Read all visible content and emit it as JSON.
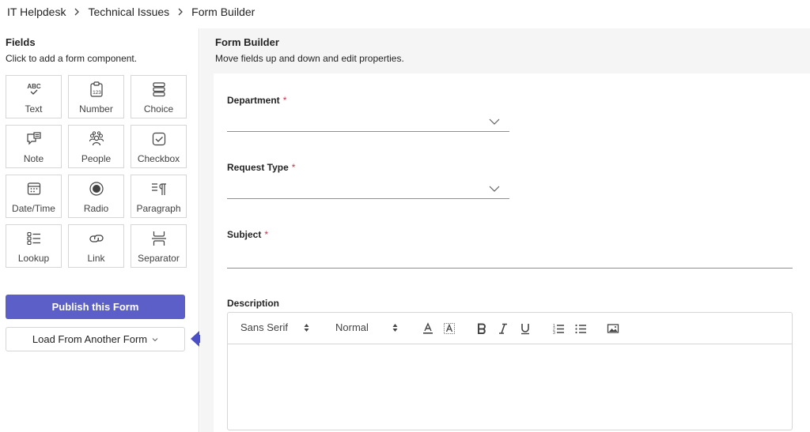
{
  "breadcrumb": [
    "IT Helpdesk",
    "Technical Issues",
    "Form Builder"
  ],
  "fields_panel": {
    "title": "Fields",
    "subtitle": "Click to add a form component.",
    "tiles": [
      {
        "label": "Text",
        "icon": "text-abc-icon"
      },
      {
        "label": "Number",
        "icon": "number-clipboard-icon"
      },
      {
        "label": "Choice",
        "icon": "choice-list-icon"
      },
      {
        "label": "Note",
        "icon": "note-comment-icon"
      },
      {
        "label": "People",
        "icon": "people-icon"
      },
      {
        "label": "Checkbox",
        "icon": "checkbox-icon"
      },
      {
        "label": "Date/Time",
        "icon": "calendar-icon"
      },
      {
        "label": "Radio",
        "icon": "radio-icon"
      },
      {
        "label": "Paragraph",
        "icon": "paragraph-icon"
      },
      {
        "label": "Lookup",
        "icon": "lookup-list-icon"
      },
      {
        "label": "Link",
        "icon": "link-icon"
      },
      {
        "label": "Separator",
        "icon": "separator-icon"
      }
    ],
    "publish_label": "Publish this Form",
    "load_label": "Load From Another Form"
  },
  "builder": {
    "title": "Form Builder",
    "subtitle": "Move fields up and down and edit properties.",
    "required_mark": "*",
    "fields": {
      "department": "Department",
      "request_type": "Request Type",
      "subject": "Subject",
      "description": "Description"
    },
    "toolbar": {
      "font": "Sans Serif",
      "size": "Normal"
    }
  },
  "colors": {
    "accent": "#5b5fc7",
    "required": "#c4314b",
    "arrow": "#4b4fc4"
  }
}
